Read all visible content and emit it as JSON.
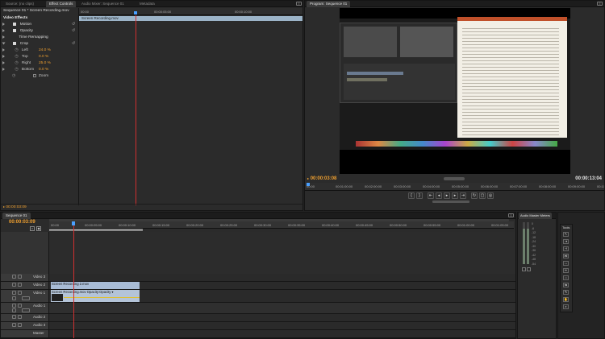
{
  "source_panel": {
    "tabs": [
      "Source: (no clips)",
      "Effect Controls",
      "Audio Mixer: Sequence 01",
      "Metadata"
    ],
    "active_tab": 1,
    "breadcrumb": "Sequence 01 * Screen Recording.mov",
    "ruler_ticks": [
      "00:00",
      "00:00:05:00",
      "00:00:10:00"
    ],
    "clip_bar_label": "Screen Recording.mov",
    "section_label": "Video Effects",
    "effects": [
      {
        "label": "Motion",
        "has_fx_box": true,
        "has_reset": true
      },
      {
        "label": "Opacity",
        "has_fx_box": true,
        "has_reset": true
      },
      {
        "label": "Time Remapping",
        "has_fx_box": false,
        "has_reset": false
      },
      {
        "label": "Crop",
        "has_fx_box": true,
        "has_reset": true
      }
    ],
    "crop_params": [
      {
        "label": "Left",
        "value": "24.0 %"
      },
      {
        "label": "Top",
        "value": "0.0 %"
      },
      {
        "label": "Right",
        "value": "25.0 %"
      },
      {
        "label": "Bottom",
        "value": "0.0 %"
      }
    ],
    "zoom_label": "Zoom",
    "timecode": "00:00:03:09"
  },
  "program_monitor": {
    "tab": "Program: Sequence 01",
    "timecode_left": "00:00:03:08",
    "timecode_right": "00:00:13:04",
    "ruler_ticks": [
      "00:00",
      "00:01:00:00",
      "00:02:00:00",
      "00:03:00:00",
      "00:04:00:00",
      "00:05:00:00",
      "00:06:00:00",
      "00:07:00:00",
      "00:08:00:00",
      "00:09:00:00",
      "00:10:00:00"
    ],
    "transport_icons": [
      "in-point",
      "out-point",
      "go-to-in",
      "step-back",
      "play",
      "step-forward",
      "go-to-out",
      "loop",
      "safe-margins",
      "export-frame"
    ]
  },
  "timeline": {
    "tab": "Sequence 01",
    "timecode": "00:00:03:09",
    "ruler_ticks": [
      "00:00",
      "00:00:05:00",
      "00:00:10:00",
      "00:00:15:00",
      "00:00:20:00",
      "00:00:25:00",
      "00:00:30:00",
      "00:00:35:00",
      "00:00:40:00",
      "00:00:45:00",
      "00:00:50:00",
      "00:00:55:00",
      "00:01:00:00",
      "00:01:05:00"
    ],
    "tracks": [
      {
        "name": "Video 3",
        "kind": "video"
      },
      {
        "name": "Video 2",
        "kind": "video"
      },
      {
        "name": "Video 1",
        "kind": "video"
      },
      {
        "name": "Audio 1",
        "kind": "audio"
      },
      {
        "name": "Audio 2",
        "kind": "audio"
      },
      {
        "name": "Audio 3",
        "kind": "audio"
      },
      {
        "name": "Master",
        "kind": "master"
      }
    ],
    "clip_video2": "Screen Recording 2.mov",
    "clip_video1": "Screen Recording.mov  Opacity:Opacity ▾"
  },
  "audio_meters": {
    "tab": "Audio Master Meters",
    "scale": [
      "0",
      "-6",
      "-12",
      "-18",
      "-24",
      "-30",
      "-36",
      "-42",
      "-48",
      "-54"
    ]
  },
  "tools": {
    "tab": "Tools",
    "icons": [
      "selection",
      "track-select",
      "ripple-edit",
      "rolling-edit",
      "rate-stretch",
      "razor",
      "slip",
      "slide",
      "pen",
      "hand",
      "zoom"
    ]
  },
  "colors": {
    "accent_orange": "#f0a030",
    "accent_blue": "#4aa0ff",
    "playhead_red": "#d03030"
  }
}
